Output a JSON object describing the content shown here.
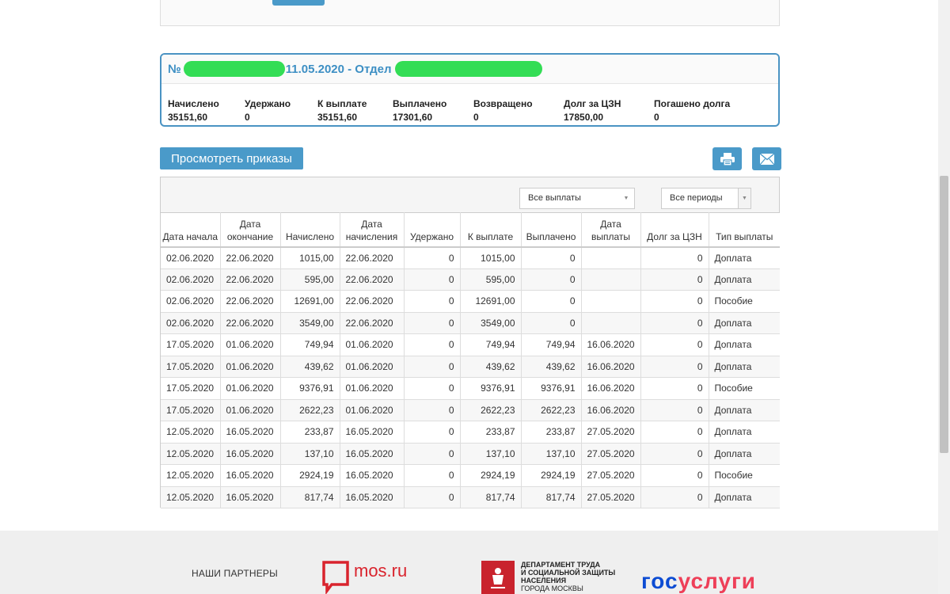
{
  "order": {
    "prefix": "№",
    "middle": "11.05.2020 - Отдел",
    "stats": [
      {
        "label": "Начислено",
        "value": "35151,60"
      },
      {
        "label": "Удержано",
        "value": "0"
      },
      {
        "label": "К выплате",
        "value": "35151,60"
      },
      {
        "label": "Выплачено",
        "value": "17301,60"
      },
      {
        "label": "Возвращено",
        "value": "0"
      },
      {
        "label": "Долг за ЦЗН",
        "value": "17850,00"
      },
      {
        "label": "Погашено долга",
        "value": "0"
      }
    ]
  },
  "actions": {
    "view_orders": "Просмотреть приказы",
    "print_icon": "printer-icon",
    "mail_icon": "envelope-icon"
  },
  "filters": {
    "payments": "Все выплаты",
    "periods": "Все периоды"
  },
  "table": {
    "headers": [
      "Дата начала",
      "Дата окончание",
      "Начислено",
      "Дата начисления",
      "Удержано",
      "К выплате",
      "Выплачено",
      "Дата выплаты",
      "Долг за ЦЗН",
      "Тип выплаты"
    ],
    "rows": [
      [
        "02.06.2020",
        "22.06.2020",
        "1015,00",
        "22.06.2020",
        "0",
        "1015,00",
        "0",
        "",
        "0",
        "Доплата"
      ],
      [
        "02.06.2020",
        "22.06.2020",
        "595,00",
        "22.06.2020",
        "0",
        "595,00",
        "0",
        "",
        "0",
        "Доплата"
      ],
      [
        "02.06.2020",
        "22.06.2020",
        "12691,00",
        "22.06.2020",
        "0",
        "12691,00",
        "0",
        "",
        "0",
        "Пособие"
      ],
      [
        "02.06.2020",
        "22.06.2020",
        "3549,00",
        "22.06.2020",
        "0",
        "3549,00",
        "0",
        "",
        "0",
        "Доплата"
      ],
      [
        "17.05.2020",
        "01.06.2020",
        "749,94",
        "01.06.2020",
        "0",
        "749,94",
        "749,94",
        "16.06.2020",
        "0",
        "Доплата"
      ],
      [
        "17.05.2020",
        "01.06.2020",
        "439,62",
        "01.06.2020",
        "0",
        "439,62",
        "439,62",
        "16.06.2020",
        "0",
        "Доплата"
      ],
      [
        "17.05.2020",
        "01.06.2020",
        "9376,91",
        "01.06.2020",
        "0",
        "9376,91",
        "9376,91",
        "16.06.2020",
        "0",
        "Пособие"
      ],
      [
        "17.05.2020",
        "01.06.2020",
        "2622,23",
        "01.06.2020",
        "0",
        "2622,23",
        "2622,23",
        "16.06.2020",
        "0",
        "Доплата"
      ],
      [
        "12.05.2020",
        "16.05.2020",
        "233,87",
        "16.05.2020",
        "0",
        "233,87",
        "233,87",
        "27.05.2020",
        "0",
        "Доплата"
      ],
      [
        "12.05.2020",
        "16.05.2020",
        "137,10",
        "16.05.2020",
        "0",
        "137,10",
        "137,10",
        "27.05.2020",
        "0",
        "Доплата"
      ],
      [
        "12.05.2020",
        "16.05.2020",
        "2924,19",
        "16.05.2020",
        "0",
        "2924,19",
        "2924,19",
        "27.05.2020",
        "0",
        "Пособие"
      ],
      [
        "12.05.2020",
        "16.05.2020",
        "817,74",
        "16.05.2020",
        "0",
        "817,74",
        "817,74",
        "27.05.2020",
        "0",
        "Доплата"
      ]
    ]
  },
  "footer": {
    "partners_title": "НАШИ ПАРТНЕРЫ",
    "mos_logo": "mos.ru",
    "dept_lines": [
      "ДЕПАРТАМЕНТ ТРУДА",
      "И СОЦИАЛЬНОЙ ЗАЩИТЫ",
      "НАСЕЛЕНИЯ",
      "ГОРОДА МОСКВЫ"
    ],
    "gos_part1": "гос",
    "gos_part2": "услуги"
  },
  "colors": {
    "accent": "#4a9ac9",
    "title_blue": "#3d8fc4",
    "redaction": "#33dd55",
    "mos_red": "#d9232d",
    "gos_blue": "#0d4cd3",
    "gos_red": "#ee3f58"
  }
}
